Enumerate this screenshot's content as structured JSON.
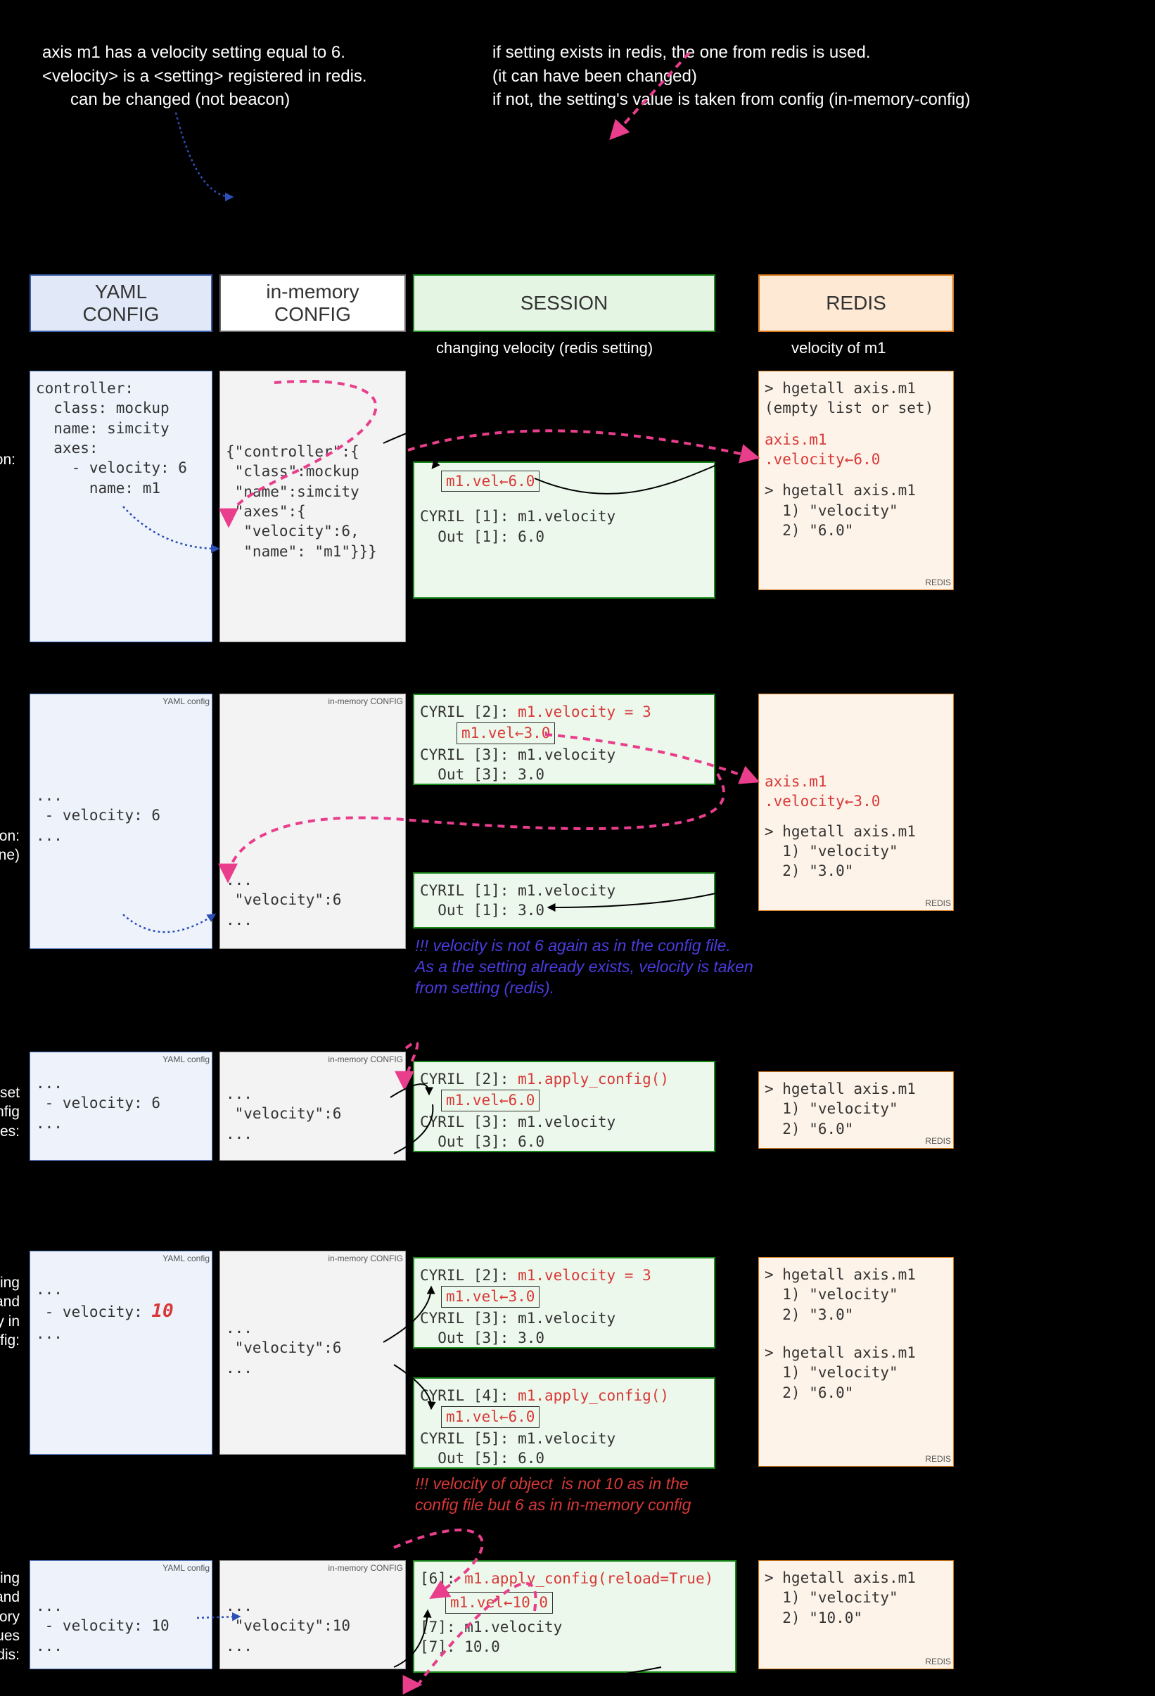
{
  "top": {
    "left1": "axis m1 has a velocity setting equal to 6.",
    "left2": "<velocity> is a <setting> registered in redis.",
    "left3": "can be changed (not beacon)",
    "right1": "if setting exists in redis, the one from redis is used.",
    "right2": "(it can have been changed)",
    "right3": "if not, the setting's value is taken from config (in-memory-config)"
  },
  "headers": {
    "yaml": "YAML\nCONFIG",
    "mem": "in-memory\nCONFIG",
    "session": "SESSION",
    "redis": "REDIS",
    "session_sub": "changing velocity (redis setting)",
    "redis_sub": "velocity of m1"
  },
  "tags": {
    "yaml": "YAML config",
    "mem": "in-memory CONFIG",
    "redis": "REDIS"
  },
  "rows": {
    "r1_label": "start session:",
    "r2_label": "re-start session:\n(or another one)",
    "r3_label": "force reset\nin-mem config\nvalues:",
    "r4_label": "After changing\nby hand\nvelocity in\nYAML config:",
    "r5_label": "to force re-reading\nof YAML config and\nreset in-memory\nconfig values\nto redis:"
  },
  "r1": {
    "yaml": "controller:\n  class: mockup\n  name: simcity\n  axes:\n    - velocity: 6\n      name: m1",
    "mem": "{\"controller\":{\n \"class\":mockup\n \"name\":simcity\n \"axes\":{\n  \"velocity\":6,\n  \"name\": \"m1\"}}}",
    "sess_box": "m1.vel←6.0",
    "sess_l1": "CYRIL [1]: m1.velocity",
    "sess_l2": "  Out [1]: 6.0",
    "redis_l1": "> hgetall axis.m1",
    "redis_l2": "(empty list or set)",
    "redis_set1": "axis.m1",
    "redis_set2": ".velocity←6.0",
    "redis_l3": "> hgetall axis.m1",
    "redis_l4": "  1) \"velocity\"",
    "redis_l5": "  2) \"6.0\""
  },
  "r2": {
    "yaml": "...\n - velocity: 6\n...",
    "mem": "...\n \"velocity\":6\n...",
    "sA_l1_pre": "CYRIL [2]: ",
    "sA_l1_cmd": "m1.velocity = 3",
    "sA_box": "m1.vel←3.0",
    "sA_l2": "CYRIL [3]: m1.velocity",
    "sA_l3": "  Out [3]: 3.0",
    "sB_l1": "CYRIL [1]: m1.velocity",
    "sB_l2": "  Out [1]: 3.0",
    "redis_set1": "axis.m1",
    "redis_set2": ".velocity←3.0",
    "redis_l1": "> hgetall axis.m1",
    "redis_l2": "  1) \"velocity\"",
    "redis_l3": "  2) \"3.0\"",
    "note": "!!! velocity is not 6 again as in the config file.\nAs a the setting already exists, velocity is taken\nfrom setting (redis)."
  },
  "r3": {
    "yaml": "...\n - velocity: 6\n...",
    "mem": "...\n \"velocity\":6\n...",
    "s_l1_pre": "CYRIL [2]: ",
    "s_l1_cmd": "m1.apply_config()",
    "s_box": "m1.vel←6.0",
    "s_l2": "CYRIL [3]: m1.velocity",
    "s_l3": "  Out [3]: 6.0",
    "redis_l1": "> hgetall axis.m1",
    "redis_l2": "  1) \"velocity\"",
    "redis_l3": "  2) \"6.0\""
  },
  "r4": {
    "yaml_pre": "...\n - velocity: ",
    "yaml_val": "10",
    "yaml_post": "\n...",
    "mem": "...\n \"velocity\":6\n...",
    "sA_l1_pre": "CYRIL [2]: ",
    "sA_l1_cmd": "m1.velocity = 3",
    "sA_box": "m1.vel←3.0",
    "sA_l2": "CYRIL [3]: m1.velocity",
    "sA_l3": "  Out [3]: 3.0",
    "sB_l1_pre": "CYRIL [4]: ",
    "sB_l1_cmd": "m1.apply_config()",
    "sB_box": "m1.vel←6.0",
    "sB_l2": "CYRIL [5]: m1.velocity",
    "sB_l3": "  Out [5]: 6.0",
    "redisA_l1": "> hgetall axis.m1",
    "redisA_l2": "  1) \"velocity\"",
    "redisA_l3": "  2) \"3.0\"",
    "redisB_l1": "> hgetall axis.m1",
    "redisB_l2": "  1) \"velocity\"",
    "redisB_l3": "  2) \"6.0\"",
    "note": "!!! velocity of object  is not 10 as in the\nconfig file but 6 as in in-memory config"
  },
  "r5": {
    "yaml": "...\n - velocity: 10\n...",
    "mem": "...\n \"velocity\":10\n...",
    "s_l1_pre": "[6]: ",
    "s_l1_cmd": "m1.apply_config(reload=True)",
    "s_box": "m1.vel←10.0",
    "s_l2": "[7]: m1.velocity",
    "s_l3": "[7]: 10.0",
    "redis_l1": "> hgetall axis.m1",
    "redis_l2": "  1) \"velocity\"",
    "redis_l3": "  2) \"10.0\""
  }
}
